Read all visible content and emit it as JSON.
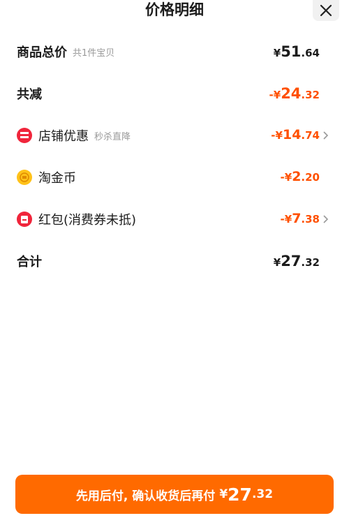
{
  "header": {
    "title": "价格明细",
    "close_icon": "close-icon"
  },
  "rows": [
    {
      "label": "商品总价",
      "sub": "共1件宝贝",
      "prefix": "¥",
      "int": "51",
      "cents": ".64"
    },
    {
      "label": "共减",
      "prefix": "-¥",
      "int": "24",
      "cents": ".32"
    },
    {
      "label": "店铺优惠",
      "sub": "秒杀直降",
      "prefix": "-¥",
      "int": "14",
      "cents": ".74",
      "icon": "shop-discount-icon"
    },
    {
      "label": "淘金币",
      "prefix": "-¥",
      "int": "2",
      "cents": ".20",
      "icon": "taojinbi-coin-icon"
    },
    {
      "label": "红包(消费券未抵)",
      "prefix": "-¥",
      "int": "7",
      "cents": ".38",
      "icon": "red-packet-icon"
    },
    {
      "label": "合计",
      "prefix": "¥",
      "int": "27",
      "cents": ".32"
    }
  ],
  "pay_button": {
    "text": "先用后付, 确认收货后再付",
    "prefix": "¥",
    "int": "27",
    "cents": ".32"
  },
  "colors": {
    "accent": "#ff5000",
    "button": "#ff6a00",
    "icon_red": "#f0253b",
    "icon_gold": "#ffc21a"
  }
}
